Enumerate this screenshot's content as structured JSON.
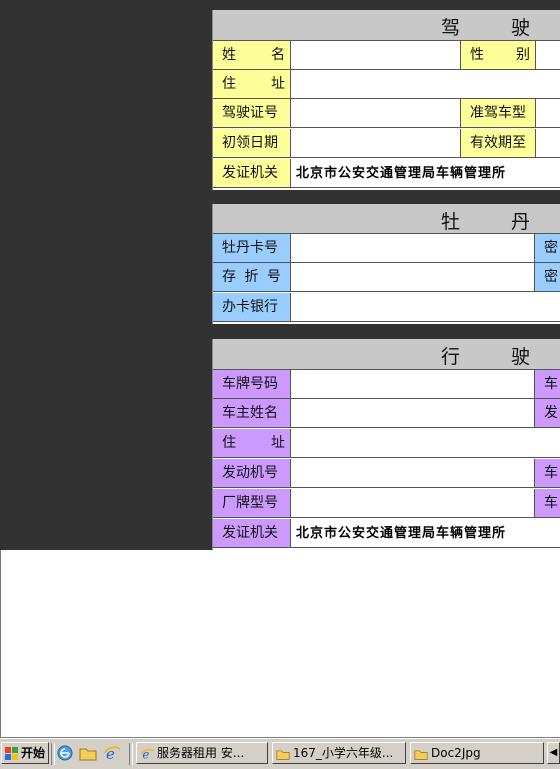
{
  "license": {
    "title_chars": [
      "驾",
      "驶"
    ],
    "rows": [
      {
        "label": "姓　　名",
        "mode": "spread",
        "right_label": "性　　别"
      },
      {
        "label": "住　　址",
        "mode": "spread"
      },
      {
        "label": "驾驶证号",
        "mode": "tight",
        "right_label": "准驾车型"
      },
      {
        "label": "初领日期",
        "mode": "tight",
        "right_label": "有效期至"
      },
      {
        "label": "发证机关",
        "mode": "tight",
        "value": "北京市公安交通管理局车辆管理所"
      }
    ]
  },
  "peony": {
    "title_chars": [
      "牡",
      "丹"
    ],
    "rows": [
      {
        "label": "牡丹卡号",
        "right_label": "密"
      },
      {
        "label": "存 折 号",
        "right_label": "密"
      },
      {
        "label": "办卡银行"
      }
    ]
  },
  "vehicle": {
    "title_chars": [
      "行",
      "驶"
    ],
    "rows": [
      {
        "label": "车牌号码",
        "right_label": "车"
      },
      {
        "label": "车主姓名",
        "right_label": "发"
      },
      {
        "label": "住　　址"
      },
      {
        "label": "发动机号",
        "right_label": "车"
      },
      {
        "label": "厂牌型号",
        "right_label": "车"
      },
      {
        "label": "发证机关",
        "value": "北京市公安交通管理局车辆管理所"
      }
    ]
  },
  "taskbar": {
    "start_label": "开始",
    "tasks": [
      "服务器租用 安...",
      "167_小学六年级...",
      "Doc2Jpg"
    ]
  },
  "colors": {
    "yellow": "#ffff99",
    "blue": "#99ccff",
    "purple": "#cc99ff",
    "header": "#c8c8c8",
    "dark": "#323232"
  }
}
